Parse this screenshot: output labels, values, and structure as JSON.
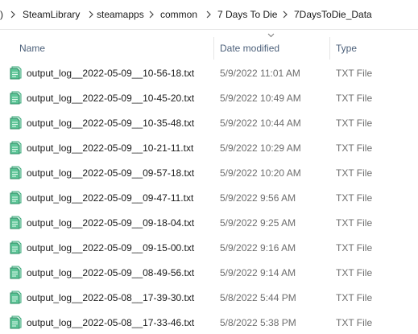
{
  "breadcrumb": {
    "lead": ")",
    "items": [
      "SteamLibrary",
      "steamapps",
      "common",
      "7 Days To Die",
      "7DaysToDie_Data"
    ]
  },
  "columns": {
    "name": "Name",
    "date_modified": "Date modified",
    "type": "Type",
    "sorted_by": "Date modified"
  },
  "files": [
    {
      "name": "output_log__2022-05-09__10-56-18.txt",
      "date": "5/9/2022 11:01 AM",
      "type": "TXT File",
      "icon": "notepad-file-icon"
    },
    {
      "name": "output_log__2022-05-09__10-45-20.txt",
      "date": "5/9/2022 10:49 AM",
      "type": "TXT File",
      "icon": "notepad-file-icon"
    },
    {
      "name": "output_log__2022-05-09__10-35-48.txt",
      "date": "5/9/2022 10:44 AM",
      "type": "TXT File",
      "icon": "notepad-file-icon"
    },
    {
      "name": "output_log__2022-05-09__10-21-11.txt",
      "date": "5/9/2022 10:29 AM",
      "type": "TXT File",
      "icon": "notepad-file-icon"
    },
    {
      "name": "output_log__2022-05-09__09-57-18.txt",
      "date": "5/9/2022 10:20 AM",
      "type": "TXT File",
      "icon": "notepad-file-icon"
    },
    {
      "name": "output_log__2022-05-09__09-47-11.txt",
      "date": "5/9/2022 9:56 AM",
      "type": "TXT File",
      "icon": "notepad-file-icon"
    },
    {
      "name": "output_log__2022-05-09__09-18-04.txt",
      "date": "5/9/2022 9:25 AM",
      "type": "TXT File",
      "icon": "notepad-file-icon"
    },
    {
      "name": "output_log__2022-05-09__09-15-00.txt",
      "date": "5/9/2022 9:16 AM",
      "type": "TXT File",
      "icon": "notepad-file-icon"
    },
    {
      "name": "output_log__2022-05-09__08-49-56.txt",
      "date": "5/9/2022 9:14 AM",
      "type": "TXT File",
      "icon": "notepad-file-icon"
    },
    {
      "name": "output_log__2022-05-08__17-39-30.txt",
      "date": "5/8/2022 5:44 PM",
      "type": "TXT File",
      "icon": "notepad-file-icon"
    },
    {
      "name": "output_log__2022-05-08__17-33-46.txt",
      "date": "5/8/2022 5:38 PM",
      "type": "TXT File",
      "icon": "notepad-file-icon"
    }
  ],
  "colors": {
    "header_text": "#4c607a",
    "meta_text": "#6d6d6d",
    "name_text": "#1a1a1a",
    "icon_green": "#3aa87a"
  }
}
